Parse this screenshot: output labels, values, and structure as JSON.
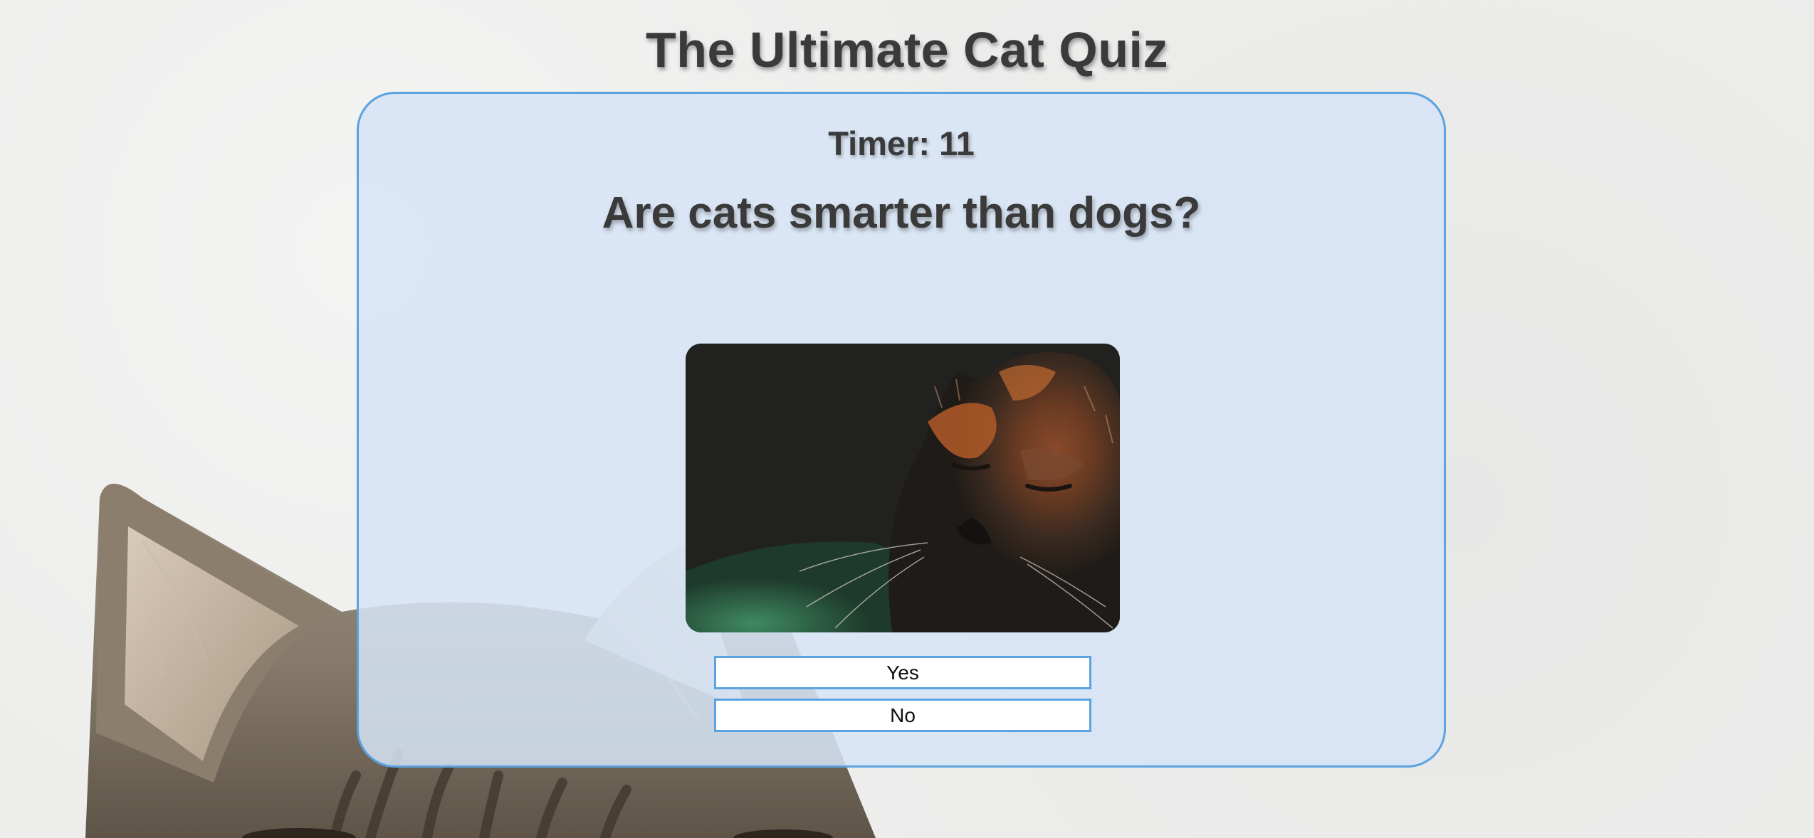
{
  "page": {
    "title": "The Ultimate Cat Quiz"
  },
  "quiz": {
    "timer_text": "Timer: 11",
    "question": "Are cats smarter than dogs?",
    "image_icon": "tortoiseshell-cat-photo",
    "answers": [
      {
        "label": "Yes"
      },
      {
        "label": "No"
      }
    ]
  },
  "colors": {
    "card_border": "#5aa3e0",
    "card_fill": "#d6e4f6",
    "text": "#3a3a3a",
    "page_background": "#ededec"
  }
}
